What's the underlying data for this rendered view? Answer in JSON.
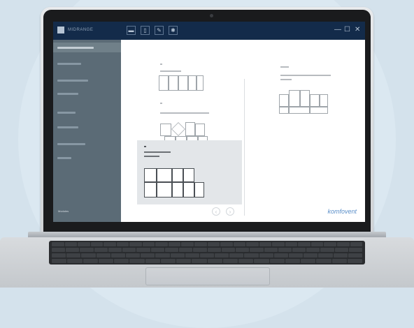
{
  "app": {
    "title": "MIDRANGE",
    "brand": "komfovent"
  },
  "toolbar": {
    "icons": [
      "folder-icon",
      "clipboard-icon",
      "wrench-icon",
      "gear-icon"
    ],
    "window_controls": [
      "minimize-icon",
      "maximize-icon",
      "close-icon"
    ]
  },
  "sidebar": {
    "items": 8,
    "footer": "Modules"
  },
  "nav": {
    "prev": "‹",
    "next": "›"
  },
  "window_control_glyphs": {
    "minimize": "—",
    "maximize": "☐",
    "close": "✕"
  },
  "colors": {
    "titlebar": "#132b4a",
    "sidebar": "#5b6b76",
    "brand": "#5b8fc9",
    "selected_panel": "#e3e6e9"
  }
}
